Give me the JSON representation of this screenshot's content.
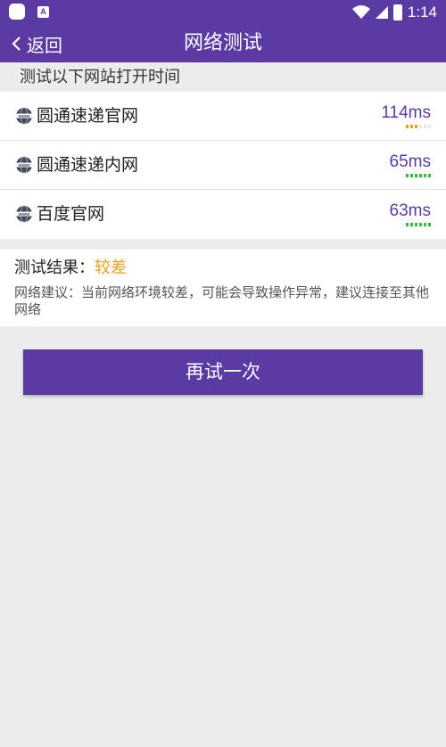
{
  "status_bar": {
    "time": "1:14",
    "small_icon_letter": "A"
  },
  "header": {
    "back_label": "返回",
    "title": "网络测试"
  },
  "section_label": "测试以下网站打开时间",
  "sites": [
    {
      "name": "圆通速递官网",
      "latency": "114ms",
      "signal_level": 3,
      "signal_color": "#e7a11b"
    },
    {
      "name": "圆通速递内网",
      "latency": "65ms",
      "signal_level": 6,
      "signal_color": "#3cb846"
    },
    {
      "name": "百度官网",
      "latency": "63ms",
      "signal_level": 6,
      "signal_color": "#3cb846"
    }
  ],
  "result": {
    "label": "测试结果：",
    "value": "较差",
    "value_color": "#e7a11b",
    "advice": "网络建议：当前网络环境较差，可能会导致操作异常，建议连接至其他网络"
  },
  "retry_button": "再试一次",
  "colors": {
    "primary": "#5c3aa3",
    "background": "#ececec"
  }
}
